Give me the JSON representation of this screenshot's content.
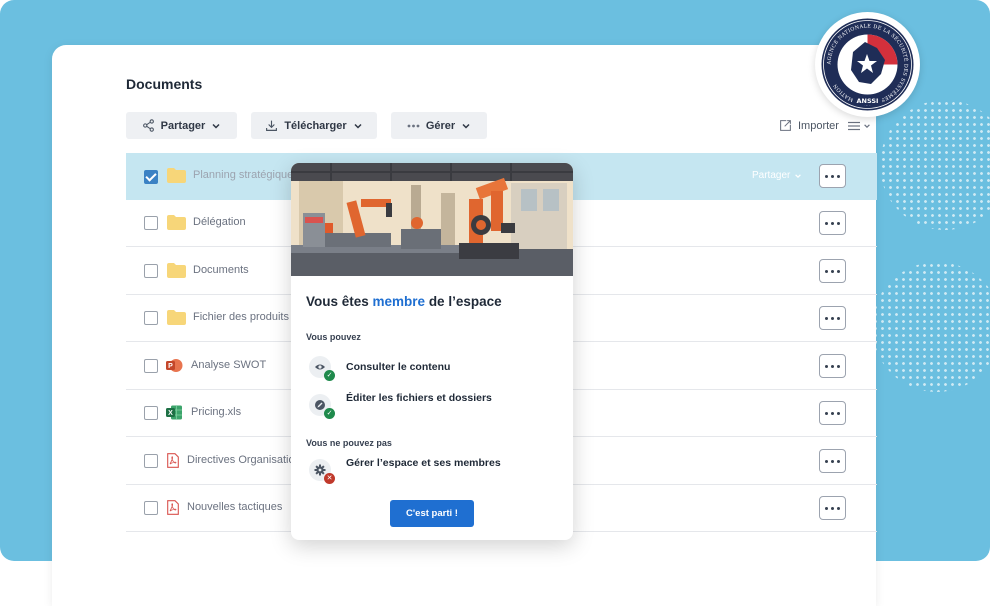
{
  "page": {
    "title": "Documents"
  },
  "toolbar": {
    "share_label": "Partager",
    "download_label": "Télécharger",
    "manage_label": "Gérer",
    "import_label": "Importer"
  },
  "files": [
    {
      "name": "Planning stratégique",
      "type": "folder",
      "selected": true,
      "share_label": "Partager"
    },
    {
      "name": "Délégation",
      "type": "folder",
      "selected": false
    },
    {
      "name": "Documents",
      "type": "folder",
      "selected": false
    },
    {
      "name": "Fichier des produits",
      "type": "folder",
      "selected": false
    },
    {
      "name": "Analyse SWOT",
      "type": "powerpoint",
      "selected": false
    },
    {
      "name": "Pricing.xls",
      "type": "excel",
      "selected": false
    },
    {
      "name": "Directives Organisationnelles",
      "type": "pdf",
      "selected": false
    },
    {
      "name": "Nouvelles tactiques",
      "type": "pdf",
      "selected": false
    }
  ],
  "modal": {
    "title_prefix": "Vous êtes ",
    "title_role": "membre",
    "title_suffix": " de l’espace",
    "can_heading": "Vous pouvez",
    "can": [
      {
        "label": "Consulter le contenu",
        "icon": "eye-icon"
      },
      {
        "label": "Éditer les fichiers et dossiers",
        "icon": "pencil-icon"
      }
    ],
    "cannot_heading": "Vous ne pouvez pas",
    "cannot": [
      {
        "label": "Gérer l’espace et ses membres",
        "icon": "gear-icon"
      }
    ],
    "cta_label": "C'est parti !"
  },
  "seal": {
    "text": "AGENCE NATIONALE DE LA SÉCURITÉ DES SYSTÈMES D'INFORMATION",
    "acronym": "ANSSI"
  },
  "colors": {
    "background": "#6bbfe0",
    "accent": "#1f6fd1",
    "selected_row": "#c5e6f1",
    "success": "#1f8a4c",
    "danger": "#c0392b"
  }
}
